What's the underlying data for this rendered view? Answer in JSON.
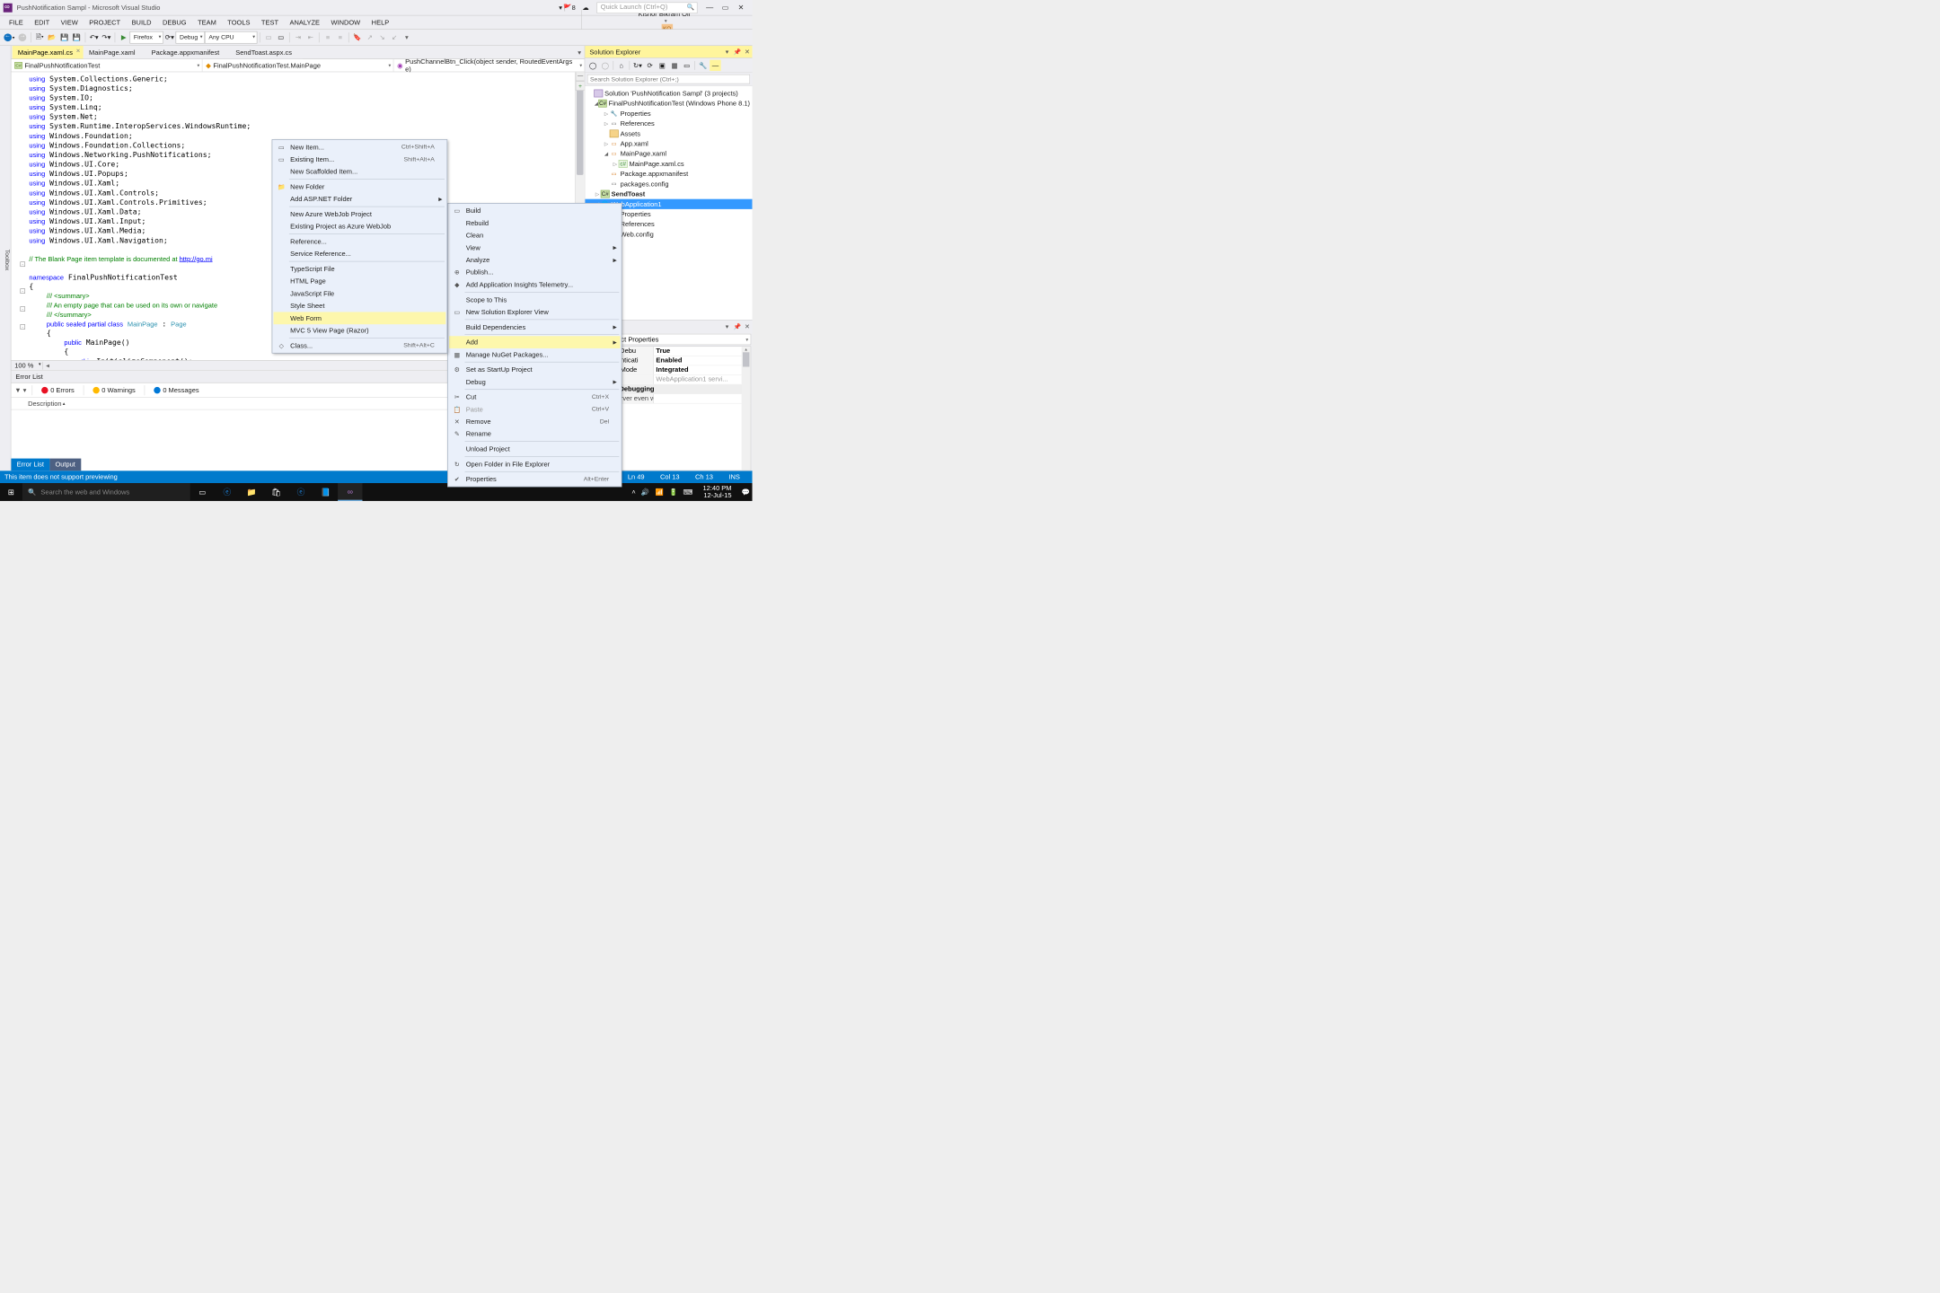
{
  "title": "PushNotification Sampl - Microsoft Visual Studio",
  "notifications": "8",
  "quicklaunch_placeholder": "Quick Launch (Ctrl+Q)",
  "user": "Kishor Bikram Oli",
  "avatar": "KO",
  "menu": [
    "FILE",
    "EDIT",
    "VIEW",
    "PROJECT",
    "BUILD",
    "DEBUG",
    "TEAM",
    "TOOLS",
    "TEST",
    "ANALYZE",
    "WINDOW",
    "HELP"
  ],
  "toolbar": {
    "browser": "Firefox",
    "config": "Debug",
    "platform": "Any CPU"
  },
  "tabs": [
    {
      "label": "MainPage.xaml.cs",
      "active": true
    },
    {
      "label": "MainPage.xaml",
      "active": false
    },
    {
      "label": "Package.appxmanifest",
      "active": false
    },
    {
      "label": "SendToast.aspx.cs",
      "active": false
    }
  ],
  "nav": {
    "project": "FinalPushNotificationTest",
    "class": "FinalPushNotificationTest.MainPage",
    "member": "PushChannelBtn_Click(object sender, RoutedEventArgs e)"
  },
  "code": {
    "usings": [
      "System.Collections.Generic",
      "System.Diagnostics",
      "System.IO",
      "System.Linq",
      "System.Net",
      "System.Runtime.InteropServices.WindowsRuntime",
      "Windows.Foundation",
      "Windows.Foundation.Collections",
      "Windows.Networking.PushNotifications",
      "Windows.UI.Core",
      "Windows.UI.Popups",
      "Windows.UI.Xaml",
      "Windows.UI.Xaml.Controls",
      "Windows.UI.Xaml.Controls.Primitives",
      "Windows.UI.Xaml.Data",
      "Windows.UI.Xaml.Input",
      "Windows.UI.Xaml.Media",
      "Windows.UI.Xaml.Navigation"
    ],
    "comment_template": "// The Blank Page item template is documented at ",
    "template_link": "http://go.mi",
    "namespace": "FinalPushNotificationTest",
    "doc1": "/// <summary>",
    "doc2": "/// An empty page that can be used on its own or navigate",
    "doc3": "/// </summary>",
    "classdecl_kw": "public sealed partial class",
    "classname": "MainPage",
    "base": "Page",
    "ctor_kw": "public",
    "ctor_name": "MainPage",
    "init_this": "this",
    "init_call": ".InitializeComponent();"
  },
  "zoom": "100 %",
  "errlist": {
    "title": "Error List",
    "errors": "0 Errors",
    "warnings": "0 Warnings",
    "messages": "0 Messages",
    "col": "Description",
    "tabs": [
      "Error List",
      "Output"
    ]
  },
  "solution": {
    "panel": "Solution Explorer",
    "search_placeholder": "Search Solution Explorer (Ctrl+;)",
    "root": "Solution 'PushNotification Sampl' (3 projects)",
    "p1": "FinalPushNotificationTest (Windows Phone 8.1)",
    "p1_items": [
      "Properties",
      "References",
      "Assets",
      "App.xaml",
      "MainPage.xaml",
      "MainPage.xaml.cs",
      "Package.appxmanifest",
      "packages.config"
    ],
    "p2": "SendToast",
    "p3": "WebApplication1",
    "p3_items": [
      "Properties",
      "References",
      "Web.config"
    ]
  },
  "properties": {
    "obj": "tion1 Project Properties",
    "rows": [
      {
        "k": "rt When Debu",
        "v": "True"
      },
      {
        "k": "us Authenticati",
        "v": "Enabled"
      },
      {
        "k": "Pipeline Mode",
        "v": "Integrated"
      },
      {
        "k": "",
        "v": ""
      }
    ],
    "cat": "t When Debugging",
    "desc": "l Web server even when not the startup pr..."
  },
  "ctx_add": [
    {
      "label": "New Item...",
      "sc": "Ctrl+Shift+A",
      "ico": "▭"
    },
    {
      "label": "Existing Item...",
      "sc": "Shift+Alt+A",
      "ico": "▭"
    },
    {
      "label": "New Scaffolded Item...",
      "sc": ""
    },
    "sep",
    {
      "label": "New Folder",
      "ico": "📁"
    },
    {
      "label": "Add ASP.NET Folder",
      "arr": true
    },
    "sep",
    {
      "label": "New Azure WebJob Project"
    },
    {
      "label": "Existing Project as Azure WebJob"
    },
    "sep",
    {
      "label": "Reference..."
    },
    {
      "label": "Service Reference..."
    },
    "sep",
    {
      "label": "TypeScript File"
    },
    {
      "label": "HTML Page"
    },
    {
      "label": "JavaScript File"
    },
    {
      "label": "Style Sheet"
    },
    {
      "label": "Web Form",
      "hl": true
    },
    {
      "label": "MVC 5 View Page (Razor)"
    },
    "sep",
    {
      "label": "Class...",
      "sc": "Shift+Alt+C",
      "ico": "◇"
    }
  ],
  "ctx_proj": [
    {
      "label": "Build",
      "ico": "▭"
    },
    {
      "label": "Rebuild"
    },
    {
      "label": "Clean"
    },
    {
      "label": "View",
      "arr": true
    },
    {
      "label": "Analyze",
      "arr": true
    },
    {
      "label": "Publish...",
      "ico": "⊕"
    },
    {
      "label": "Add Application Insights Telemetry...",
      "ico": "◆"
    },
    "sep",
    {
      "label": "Scope to This"
    },
    {
      "label": "New Solution Explorer View",
      "ico": "▭"
    },
    "sep",
    {
      "label": "Build Dependencies",
      "arr": true
    },
    "sep",
    {
      "label": "Add",
      "arr": true,
      "hl": true
    },
    {
      "label": "Manage NuGet Packages...",
      "ico": "▦"
    },
    "sep",
    {
      "label": "Set as StartUp Project",
      "ico": "⚙"
    },
    {
      "label": "Debug",
      "arr": true
    },
    "sep",
    {
      "label": "Cut",
      "sc": "Ctrl+X",
      "ico": "✂"
    },
    {
      "label": "Paste",
      "sc": "Ctrl+V",
      "ico": "📋",
      "dis": true
    },
    {
      "label": "Remove",
      "sc": "Del",
      "ico": "✕"
    },
    {
      "label": "Rename",
      "ico": "✎"
    },
    "sep",
    {
      "label": "Unload Project"
    },
    "sep",
    {
      "label": "Open Folder in File Explorer",
      "ico": "↻"
    },
    "sep",
    {
      "label": "Properties",
      "sc": "Alt+Enter",
      "ico": "✔"
    }
  ],
  "status": {
    "msg": "This item does not support previewing",
    "ln": "Ln 49",
    "col": "Col 13",
    "ch": "Ch 13",
    "ins": "INS"
  },
  "taskbar": {
    "search": "Search the web and Windows",
    "time": "12:40 PM",
    "date": "12-Jul-15"
  }
}
